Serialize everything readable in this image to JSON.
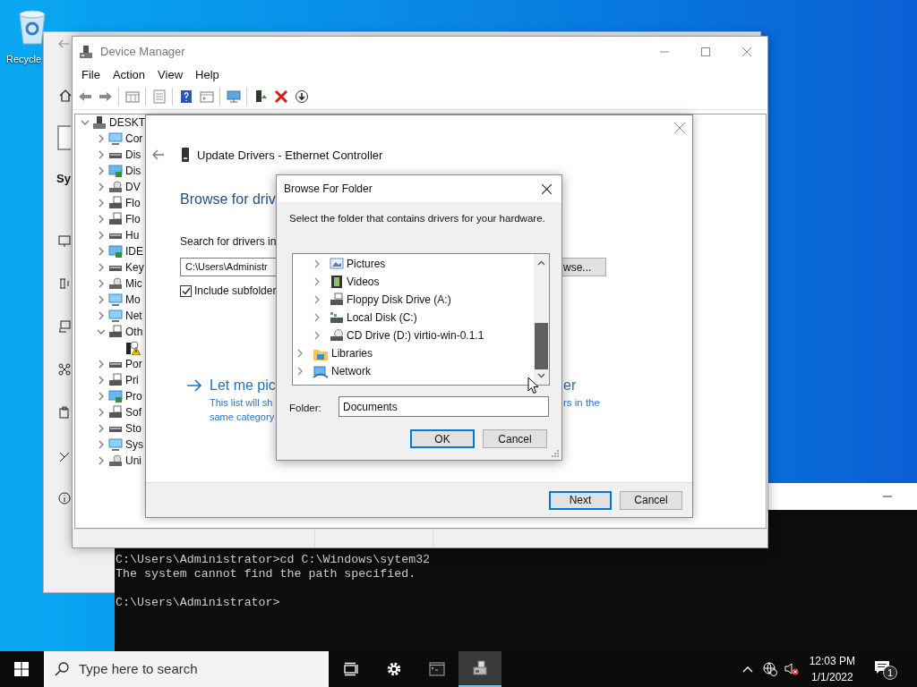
{
  "desktop_icons": [
    {
      "label": "Recycle"
    }
  ],
  "settings_window": {
    "heading": "Sy"
  },
  "console": {
    "output": [
      "C:\\Users\\Administrator>cd C:\\Windows\\sytem32",
      "The system cannot find the path specified."
    ],
    "prompt": "C:\\Users\\Administrator>"
  },
  "device_manager": {
    "title": "Device Manager",
    "menu": [
      "File",
      "Action",
      "View",
      "Help"
    ],
    "tree": {
      "label": "DESKT",
      "expanded": true,
      "children": [
        {
          "label": "Cor",
          "expanded": false
        },
        {
          "label": "Dis",
          "expanded": false
        },
        {
          "label": "Dis",
          "expanded": false
        },
        {
          "label": "DV",
          "expanded": false
        },
        {
          "label": "Flo",
          "expanded": false
        },
        {
          "label": "Flo",
          "expanded": false
        },
        {
          "label": "Hu",
          "expanded": false
        },
        {
          "label": "IDE",
          "expanded": false
        },
        {
          "label": "Key",
          "expanded": false
        },
        {
          "label": "Mic",
          "expanded": false
        },
        {
          "label": "Mo",
          "expanded": false
        },
        {
          "label": "Net",
          "expanded": false
        },
        {
          "label": "Oth",
          "expanded": true,
          "children": [
            {
              "warning": true
            }
          ]
        },
        {
          "label": "Por",
          "expanded": false
        },
        {
          "label": "Pri",
          "expanded": false
        },
        {
          "label": "Pro",
          "expanded": false
        },
        {
          "label": "Sof",
          "expanded": false
        },
        {
          "label": "Sto",
          "expanded": false
        },
        {
          "label": "Sys",
          "expanded": false
        },
        {
          "label": "Uni",
          "expanded": false
        }
      ]
    }
  },
  "update_dialog": {
    "title": "Update Drivers - Ethernet Controller",
    "heading": "Browse for driv",
    "search_label": "Search for drivers in",
    "path_value": "C:\\Users\\Administr",
    "browse_button": "wse...",
    "include_subfolders": {
      "label": "Include subfolder",
      "checked": true
    },
    "pick_link": {
      "title_left": "Let me pic",
      "title_right": "er",
      "description_left": [
        "This list will sh",
        "same category"
      ],
      "description_right": "rs in the"
    },
    "buttons": [
      {
        "label": "Next",
        "default": true
      },
      {
        "label": "Cancel",
        "default": false
      }
    ]
  },
  "browse_dialog": {
    "title": "Browse For Folder",
    "instruction": "Select the folder that contains drivers for your hardware.",
    "tree": [
      {
        "children": [
          {
            "label": "Pictures"
          },
          {
            "label": "Videos"
          },
          {
            "label": "Floppy Disk Drive (A:)"
          },
          {
            "label": "Local Disk (C:)"
          },
          {
            "label": "CD Drive (D:) virtio-win-0.1.1"
          }
        ]
      },
      {
        "label": "Libraries"
      },
      {
        "label": "Network"
      }
    ],
    "folder_label": "Folder:",
    "folder_value": "Documents",
    "buttons": [
      {
        "label": "OK",
        "default": true
      },
      {
        "label": "Cancel",
        "default": false
      }
    ]
  },
  "taskbar": {
    "search_placeholder": "Type here to search",
    "apps": [
      {
        "selected": false
      },
      {
        "selected": false
      },
      {
        "selected": true
      }
    ],
    "clock": {
      "time": "12:03 PM",
      "date": "1/1/2022"
    },
    "notification_count": "1"
  }
}
